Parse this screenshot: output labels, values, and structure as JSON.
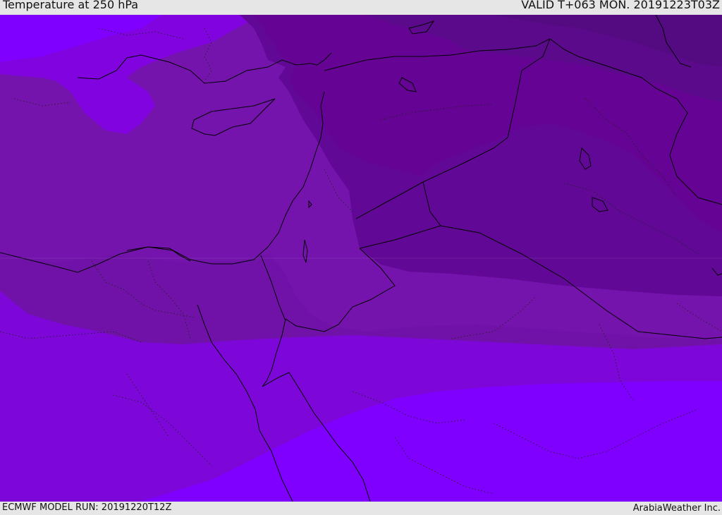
{
  "header": {
    "title": "Temperature at 250 hPa",
    "valid": "VALID T+063 MON. 20191223T03Z"
  },
  "footer": {
    "model_run": "ECMWF MODEL RUN: 20191220T12Z",
    "credit": "ArabiaWeather Inc."
  },
  "map": {
    "parameter": "temperature",
    "level": "250 hPa",
    "region": "Eastern Mediterranean and Middle East",
    "contour_colors": {
      "band_darkest": "#5a0a8a",
      "band_dark": "#620896",
      "band_mid": "#6c0ba3",
      "band_mid_light": "#7513ad",
      "band_light": "#7d06d9",
      "band_lightest": "#8000ff"
    },
    "border_color": "#000000"
  }
}
